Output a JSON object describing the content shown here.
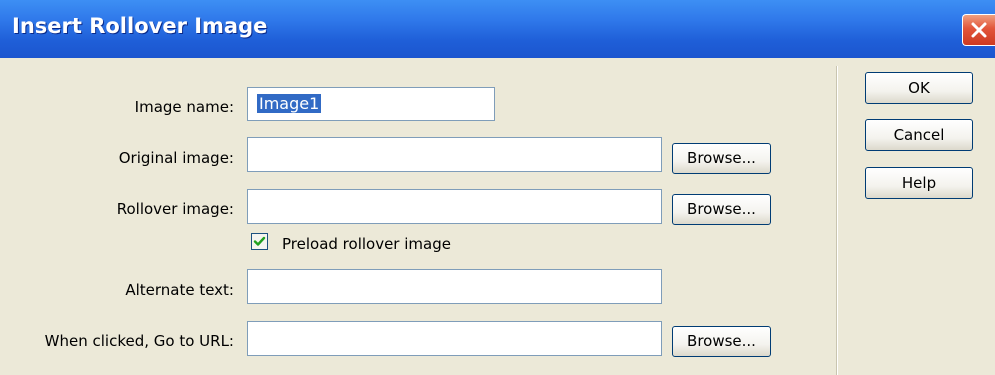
{
  "window": {
    "title": "Insert Rollover Image"
  },
  "form": {
    "image_name": {
      "label": "Image name:",
      "value": "Image1"
    },
    "original_image": {
      "label": "Original image:",
      "value": "",
      "browse_label": "Browse..."
    },
    "rollover_image": {
      "label": "Rollover image:",
      "value": "",
      "browse_label": "Browse..."
    },
    "preload": {
      "label": "Preload rollover image",
      "checked": true
    },
    "alternate_text": {
      "label": "Alternate text:",
      "value": ""
    },
    "url": {
      "label": "When clicked, Go to URL:",
      "value": "",
      "browse_label": "Browse..."
    }
  },
  "actions": {
    "ok_label": "OK",
    "cancel_label": "Cancel",
    "help_label": "Help"
  },
  "colors": {
    "title_bar": "#2f78ea",
    "dialog_bg": "#ece9d8",
    "close_button": "#e2553a",
    "selection": "#316ac5"
  },
  "icons": {
    "close": "close-icon",
    "check": "checkmark-icon"
  }
}
